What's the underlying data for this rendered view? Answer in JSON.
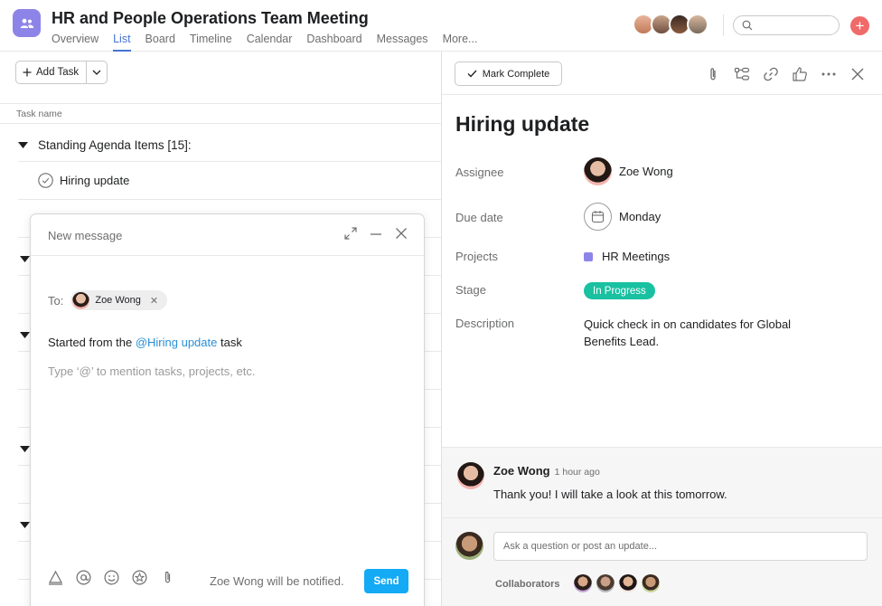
{
  "header": {
    "title": "HR and People Operations Team Meeting",
    "tabs": [
      "Overview",
      "List",
      "Board",
      "Timeline",
      "Calendar",
      "Dashboard",
      "Messages",
      "More..."
    ],
    "active_tab": "List",
    "plus_label": "+"
  },
  "list": {
    "add_task_label": "Add Task",
    "column_header": "Task name",
    "section_label": "Standing Agenda Items [15]:",
    "task_label": "Hiring update"
  },
  "compose": {
    "title": "New message",
    "to_label": "To:",
    "recipient": "Zoe Wong",
    "body_prefix": "Started from the ",
    "body_mention": "@Hiring update",
    "body_suffix": " task",
    "placeholder": "Type ‘@’ to mention tasks, projects, etc.",
    "notified_text": "Zoe Wong will be notified.",
    "send_label": "Send"
  },
  "detail": {
    "mark_complete_label": "Mark Complete",
    "task_title": "Hiring update",
    "fields": {
      "assignee_label": "Assignee",
      "assignee_value": "Zoe Wong",
      "due_label": "Due date",
      "due_value": "Monday",
      "projects_label": "Projects",
      "projects_value": "HR Meetings",
      "stage_label": "Stage",
      "stage_value": "In Progress",
      "description_label": "Description",
      "description_value": "Quick check in on candidates for Global Benefits Lead."
    },
    "comment": {
      "author": "Zoe Wong",
      "time": "1 hour ago",
      "text": "Thank you! I will take a look at this tomorrow."
    },
    "reply_placeholder": "Ask a question or post an update...",
    "collaborators_label": "Collaborators"
  },
  "colors": {
    "accent": "#4573d2",
    "project": "#8d84e8",
    "stage": "#19c1a1",
    "send": "#14aaf5",
    "plus": "#f06a6a",
    "mention": "#2a8fd6"
  }
}
